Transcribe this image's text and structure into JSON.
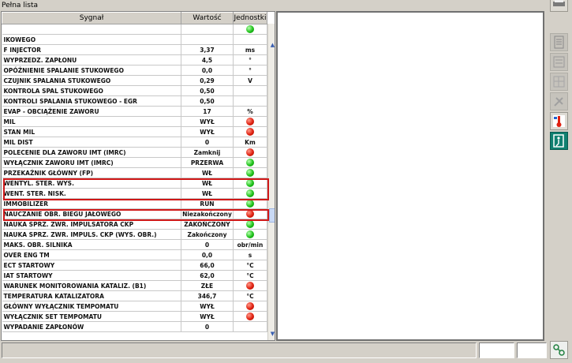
{
  "panel": {
    "title": "Pełna lista"
  },
  "columns": {
    "signal": "Sygnał",
    "value": "Wartość",
    "unit": "Jednostki"
  },
  "rows": [
    {
      "name": "",
      "value": "",
      "unit": "",
      "indicator": "green"
    },
    {
      "name": "IKOWEGO",
      "value": "",
      "unit": ""
    },
    {
      "name": "F INJECTOR",
      "value": "3,37",
      "unit": "ms"
    },
    {
      "name": "WYPRZEDZ. ZAPŁONU",
      "value": "4,5",
      "unit": "°"
    },
    {
      "name": "OPÓŹNIENIE SPALANIE STUKOWEGO",
      "value": "0,0",
      "unit": "°"
    },
    {
      "name": "CZUJNIK SPALANIA STUKOWEGO",
      "value": "0,29",
      "unit": "V"
    },
    {
      "name": "KONTROLA SPAL STUKOWEGO",
      "value": "0,50",
      "unit": ""
    },
    {
      "name": "KONTROLI SPALANIA STUKOWEGO - EGR",
      "value": "0,50",
      "unit": ""
    },
    {
      "name": "EVAP - OBCIĄŻENIE ZAWORU",
      "value": "17",
      "unit": "%"
    },
    {
      "name": "MIL",
      "value": "WYŁ",
      "unit": "",
      "indicator": "red"
    },
    {
      "name": "Stan MIL",
      "value": "WYŁ",
      "unit": "",
      "indicator": "red"
    },
    {
      "name": "MIL DIST",
      "value": "0",
      "unit": "Km"
    },
    {
      "name": "POLECENIE DLA ZAWORU IMT (IMRC)",
      "value": "Zamknij",
      "unit": "",
      "indicator": "red"
    },
    {
      "name": "WYŁĄCZNIK ZAWORU IMT (IMRC)",
      "value": "PRZERWA",
      "unit": "",
      "indicator": "green"
    },
    {
      "name": "PRZEKAŹNIK GŁÓWNY (FP)",
      "value": "WŁ",
      "unit": "",
      "indicator": "green"
    },
    {
      "name": "WENTYL. STER. WYS.",
      "value": "WŁ",
      "unit": "",
      "indicator": "green",
      "highlight": true
    },
    {
      "name": "WENT. STER. NISK.",
      "value": "WŁ",
      "unit": "",
      "indicator": "green",
      "highlight": true
    },
    {
      "name": "IMMOBILIZER",
      "value": "RUN",
      "unit": "",
      "indicator": "green"
    },
    {
      "name": "NAUCZANIE OBR. BIEGU JAŁOWEGO",
      "value": "Niezakończony",
      "unit": "",
      "indicator": "red",
      "highlight": true
    },
    {
      "name": "NAUKA SPRZ. ZWR. IMPULSATORA CKP",
      "value": "ZAKOŃCZONY",
      "unit": "",
      "indicator": "green"
    },
    {
      "name": "NAUKA SPRZ. ZWR. IMPULS. CKP (WYS. OBR.)",
      "value": "Zakończony",
      "unit": "",
      "indicator": "green"
    },
    {
      "name": "MAKS. OBR. SILNIKA",
      "value": "0",
      "unit": "obr/min"
    },
    {
      "name": "OVER ENG TM",
      "value": "0,0",
      "unit": "s"
    },
    {
      "name": "ECT STARTOWY",
      "value": "66,0",
      "unit": "°C"
    },
    {
      "name": "IAT STARTOWY",
      "value": "62,0",
      "unit": "°C"
    },
    {
      "name": "WARUNEK MONITOROWANIA KATALIZ. (B1)",
      "value": "ZŁE",
      "unit": "",
      "indicator": "red"
    },
    {
      "name": "TEMPERATURA KATALIZATORA",
      "value": "346,7",
      "unit": "°C"
    },
    {
      "name": "GŁÓWNY WYŁĄCZNIK TEMPOMATU",
      "value": "WYŁ",
      "unit": "",
      "indicator": "red"
    },
    {
      "name": "WYŁĄCZNIK SET TEMPOMATU",
      "value": "WYŁ",
      "unit": "",
      "indicator": "red"
    },
    {
      "name": "WYPADANIE ZAPŁONÓW",
      "value": "0",
      "unit": ""
    }
  ],
  "scroll": {
    "up": "▲",
    "down": "▼"
  },
  "toolbar": {
    "icons": [
      "printer-icon",
      "document-icon",
      "list-icon",
      "grid-icon",
      "tools-icon",
      "thermometer-icon",
      "exit-icon",
      "connection-icon"
    ]
  },
  "colors": {
    "highlight": "#d01818",
    "indicator_red": "#e02010",
    "indicator_green": "#1fc21a"
  }
}
